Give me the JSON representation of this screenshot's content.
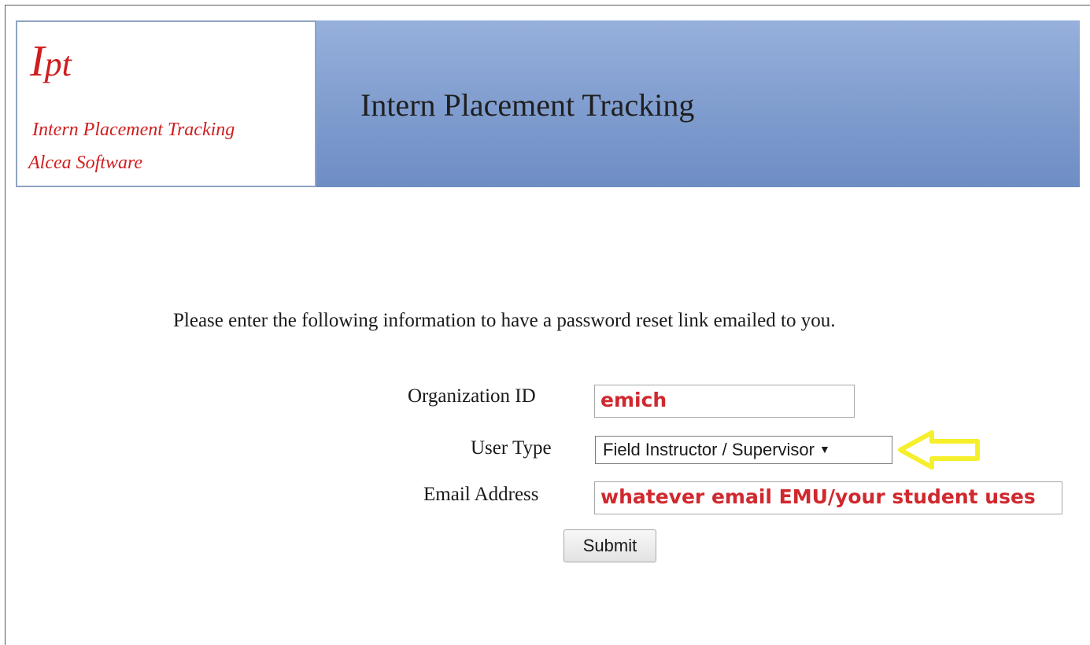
{
  "header": {
    "logo": {
      "mark_initial": "I",
      "mark_rest": "pt",
      "line1": "Intern Placement Tracking",
      "line2": "Alcea Software"
    },
    "title": "Intern Placement Tracking"
  },
  "instructions": "Please enter the following information to have a password reset link emailed to you.",
  "form": {
    "organization_id": {
      "label": "Organization ID",
      "value": "emich"
    },
    "user_type": {
      "label": "User Type",
      "selected": "Field Instructor / Supervisor"
    },
    "email": {
      "label": "Email Address",
      "value": "whatever email EMU/your student uses"
    },
    "submit_label": "Submit"
  },
  "annotation": {
    "arrow_icon": "yellow-left-arrow",
    "arrow_color": "#f6ef2c",
    "annotation_text_color": "#d0282e"
  },
  "colors": {
    "banner": "#7f9cce",
    "logo_text": "#cf1e1e"
  }
}
